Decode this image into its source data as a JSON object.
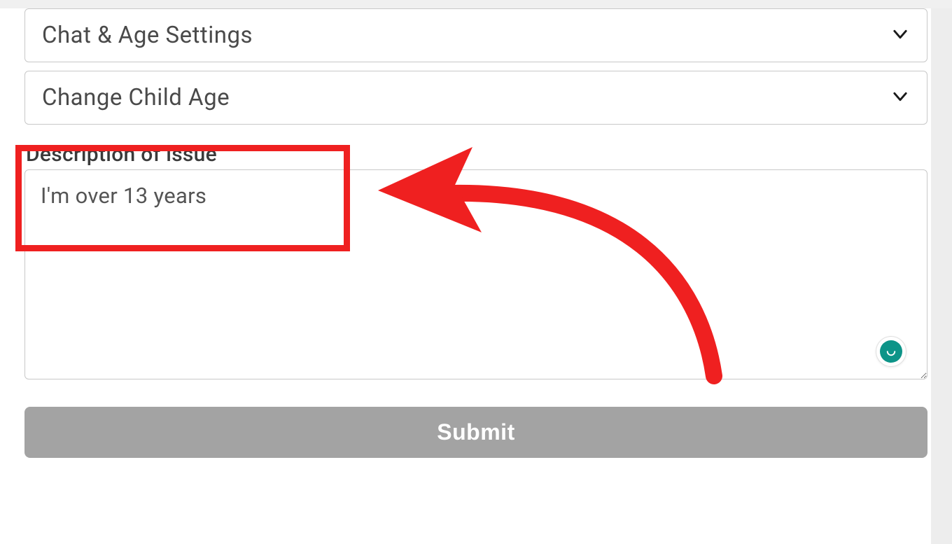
{
  "form": {
    "dropdowns": [
      {
        "label": "Chat & Age Settings"
      },
      {
        "label": "Change Child Age"
      }
    ],
    "description": {
      "label": "Description of issue",
      "value": "I'm over 13 years"
    },
    "submit_label": "Submit"
  },
  "annotations": {
    "highlight_box": true,
    "arrow": true
  },
  "colors": {
    "annotation": "#ef2020",
    "submit_bg": "#a3a3a3",
    "text": "#4a4a4a",
    "grammarly": "#0d9488"
  }
}
